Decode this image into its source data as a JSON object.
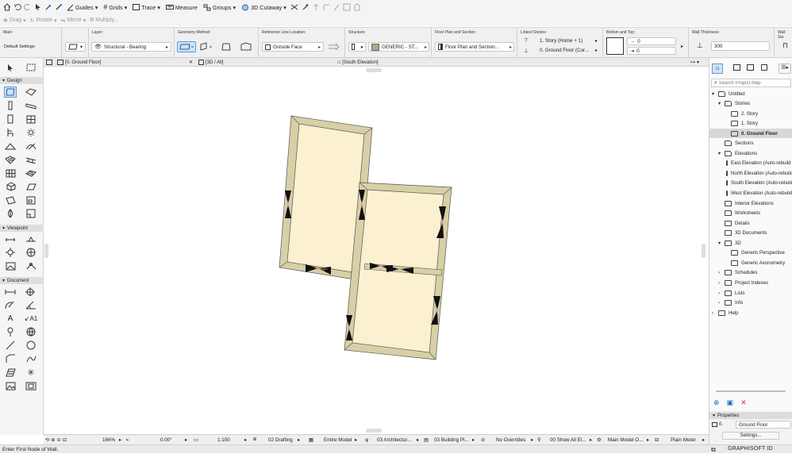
{
  "toolbar": {
    "guides": "Guides",
    "grids": "Grids",
    "trace": "Trace",
    "measure": "Measure",
    "groups": "Groups",
    "cutaway": "3D Cutaway",
    "drag": "Drag",
    "rotate": "Rotate",
    "mirror": "Mirror",
    "multiply": "Multiply..."
  },
  "infobox": {
    "main_label": "Main:",
    "default_settings": "Default Settings",
    "layer_label": "Layer:",
    "layer_value": "Structural - Bearing",
    "geometry_label": "Geometry Method:",
    "refline_label": "Reference Line Location:",
    "refline_value": "Outside Face",
    "structure_label": "Structure:",
    "structure_value": "GENERIC - ST...",
    "floorplan_label": "Floor Plan and Section:",
    "floorplan_value": "Floor Plan and Section...",
    "linked_label": "Linked Stories:",
    "linked_top": "1. Story (Home + 1)",
    "linked_bottom": "0. Ground Floor (Cur...",
    "bottomtop_label": "Bottom and Top:",
    "top_offset": "0",
    "bottom_offset": "0",
    "thickness_label": "Wall Thickness:",
    "thickness_value": "300",
    "slant_label": "Wall Sla"
  },
  "tabs": {
    "floor": "[0. Ground Floor]",
    "view3d": "[3D / All]",
    "elevation": "[South Elevation]"
  },
  "toolbox": {
    "design": "Design",
    "viewpoint": "Viewpoint",
    "document": "Document"
  },
  "navigator": {
    "search_placeholder": "Search Project Map",
    "items": [
      "Untitled",
      "Stories",
      "2. Story",
      "1. Story",
      "0. Ground Floor",
      "Sections",
      "Elevations",
      "East Elevation (Auto-rebuild Model)",
      "North Elevation (Auto-rebuild Model)",
      "South Elevation (Auto-rebuild Model)",
      "West Elevation (Auto-rebuild Model)",
      "Interior Elevations",
      "Worksheets",
      "Details",
      "3D Documents",
      "3D",
      "Generic Perspective",
      "Generic Axonometry",
      "Schedules",
      "Project Indexes",
      "Lists",
      "Info",
      "Help"
    ]
  },
  "properties": {
    "header": "Properties",
    "story_num": "0.",
    "story_name": "Ground Floor",
    "settings": "Settings..."
  },
  "status": {
    "zoom": "166%",
    "angle": "0.00°",
    "scale": "1:100",
    "layer_combo": "02 Drafting",
    "model": "Entire Model",
    "pen_set": "03 Architectur...",
    "mvo": "03 Building Pl...",
    "override": "No Overrides",
    "renovation": "00 Show All El...",
    "structure": "Main Model O...",
    "dimension": "Plain Meter"
  },
  "bottom": {
    "prompt": "Enter First Node of Wall.",
    "brand": "GRAPHISOFT ID"
  },
  "colors": {
    "accent": "#5b9bd5",
    "wall_fill": "#d8cfa6",
    "room_fill": "#fbf0cf",
    "selection": "#cfe3f6"
  }
}
